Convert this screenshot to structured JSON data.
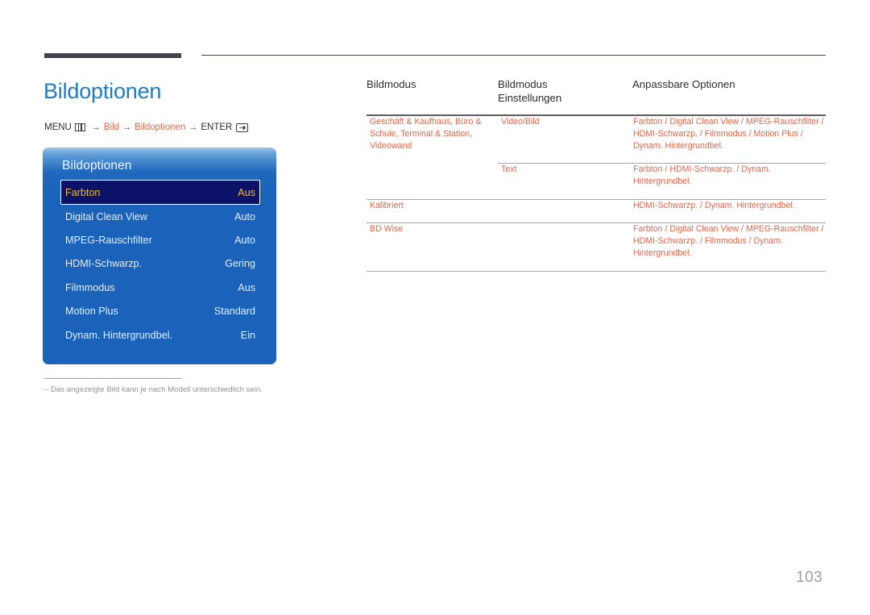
{
  "document": {
    "page_number": "103"
  },
  "heading": {
    "title": "Bildoptionen"
  },
  "breadcrumb": {
    "menu_label": "MENU",
    "menu_icon": "menu-grid-icon",
    "arrow": "→",
    "step1": "Bild",
    "step2": "Bildoptionen",
    "enter_label": "ENTER",
    "enter_icon": "enter-key-icon"
  },
  "osd": {
    "title": "Bildoptionen",
    "rows": [
      {
        "label": "Farbton",
        "value": "Aus",
        "selected": true
      },
      {
        "label": "Digital Clean View",
        "value": "Auto",
        "selected": false
      },
      {
        "label": "MPEG-Rauschfilter",
        "value": "Auto",
        "selected": false
      },
      {
        "label": "HDMI-Schwarzp.",
        "value": "Gering",
        "selected": false
      },
      {
        "label": "Filmmodus",
        "value": "Aus",
        "selected": false
      },
      {
        "label": "Motion Plus",
        "value": "Standard",
        "selected": false
      },
      {
        "label": "Dynam. Hintergrundbel.",
        "value": "Ein",
        "selected": false
      }
    ]
  },
  "footnote": {
    "text": "–  Das angezeigte Bild kann je nach Modell unterschiedlich sein."
  },
  "table": {
    "headers": {
      "col1": "Bildmodus",
      "col2_line1": "Bildmodus",
      "col2_line2": "Einstellungen",
      "col3": "Anpassbare Optionen"
    },
    "rows": [
      {
        "col1": "Geschäft & Kaufhaus, Büro & Schule, Terminal & Station, Videowand",
        "col2": "Video/Bild",
        "col3": "Farbton / Digital Clean View / MPEG-Rauschfilter / HDMI-Schwarzp. / Filmmodus / Motion Plus / Dynam. Hintergrundbel."
      },
      {
        "col1": "",
        "col2": "Text",
        "col3": "Farbton / HDMI-Schwarzp. / Dynam. Hintergrundbel."
      },
      {
        "col1": "Kalibriert",
        "col2": "",
        "col3": "HDMI-Schwarzp. / Dynam. Hintergrundbel."
      },
      {
        "col1": "BD Wise",
        "col2": "",
        "col3": "Farbton / Digital Clean View / MPEG-Rauschfilter / HDMI-Schwarzp. / Filmmodus / Dynam. Hintergrundbel."
      }
    ]
  },
  "colors": {
    "accent_blue": "#1f7cc2",
    "accent_orange": "#e2664a",
    "osd_blue": "#1a62ba",
    "osd_selected_bg": "#0b1268",
    "osd_selected_text": "#f3bc20",
    "rule_dark": "#45424f",
    "muted_gray": "#8d939c"
  }
}
